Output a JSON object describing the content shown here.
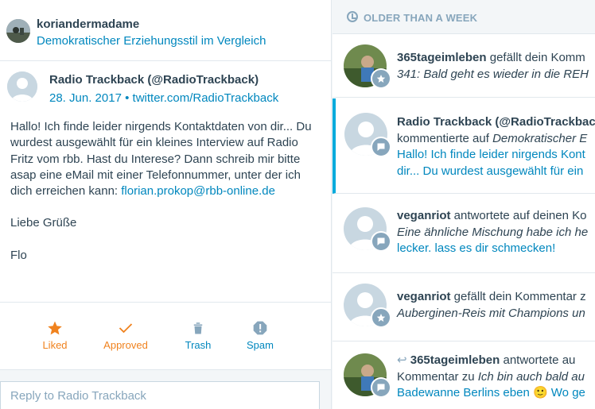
{
  "post": {
    "site_user": "koriandermadame",
    "post_title": "Demokratischer Erziehungsstil im Vergleich"
  },
  "comment": {
    "author": "Radio Trackback (@RadioTrackback)",
    "date": "28. Jun. 2017",
    "separator": "•",
    "source": "twitter.com/RadioTrackback",
    "body_text": "Hallo! Ich finde leider nirgends Kontaktdaten von dir... Du wurdest ausgewählt für ein kleines Interview auf Radio Fritz vom rbb. Hast du Interese? Dann schreib mir bitte asap eine eMail mit einer Telefonnummer, unter der ich dich erreichen kann: ",
    "body_link": "florian.prokop@rbb-online.de",
    "greeting": "Liebe Grüße",
    "signature": "Flo"
  },
  "actions": {
    "liked": "Liked",
    "approved": "Approved",
    "trash": "Trash",
    "spam": "Spam"
  },
  "reply": {
    "placeholder": "Reply to Radio Trackback"
  },
  "notifications": {
    "section_title": "OLDER THAN A WEEK",
    "items": [
      {
        "user": "365tageimleben",
        "action": " gefällt dein Komm",
        "line2": "341: Bald geht es wieder in die REH",
        "badge": "star-icon"
      },
      {
        "user": "Radio Trackback (@RadioTrackbac",
        "line2_prefix": "kommentierte auf ",
        "line2_italic": "Demokratischer E",
        "line3": "Hallo! Ich finde leider nirgends Kont",
        "line4": "dir... Du wurdest ausgewählt für ein",
        "badge": "comment-icon"
      },
      {
        "user": "veganriot",
        "action": " antwortete auf deinen Ko",
        "line2": "Eine ähnliche Mischung habe ich he",
        "line3": "lecker. lass es dir schmecken!",
        "badge": "comment-icon"
      },
      {
        "user": "veganriot",
        "action": " gefällt dein Kommentar z",
        "line2": "Auberginen-Reis mit Champions un",
        "badge": "star-icon"
      },
      {
        "reply_glyph": "↩",
        "user": "365tageimleben",
        "action": " antwortete au",
        "line2_prefix": "Kommentar zu ",
        "line2_italic": "Ich bin auch bald au",
        "line3": "Badewanne Berlins eben 🙂 Wo ge",
        "badge": "comment-icon"
      }
    ]
  },
  "colors": {
    "accent_blue": "#0087be",
    "accent_orange": "#f0821e",
    "unread_bar": "#00aadc",
    "muted": "#87a6bc",
    "text": "#2e4453"
  }
}
